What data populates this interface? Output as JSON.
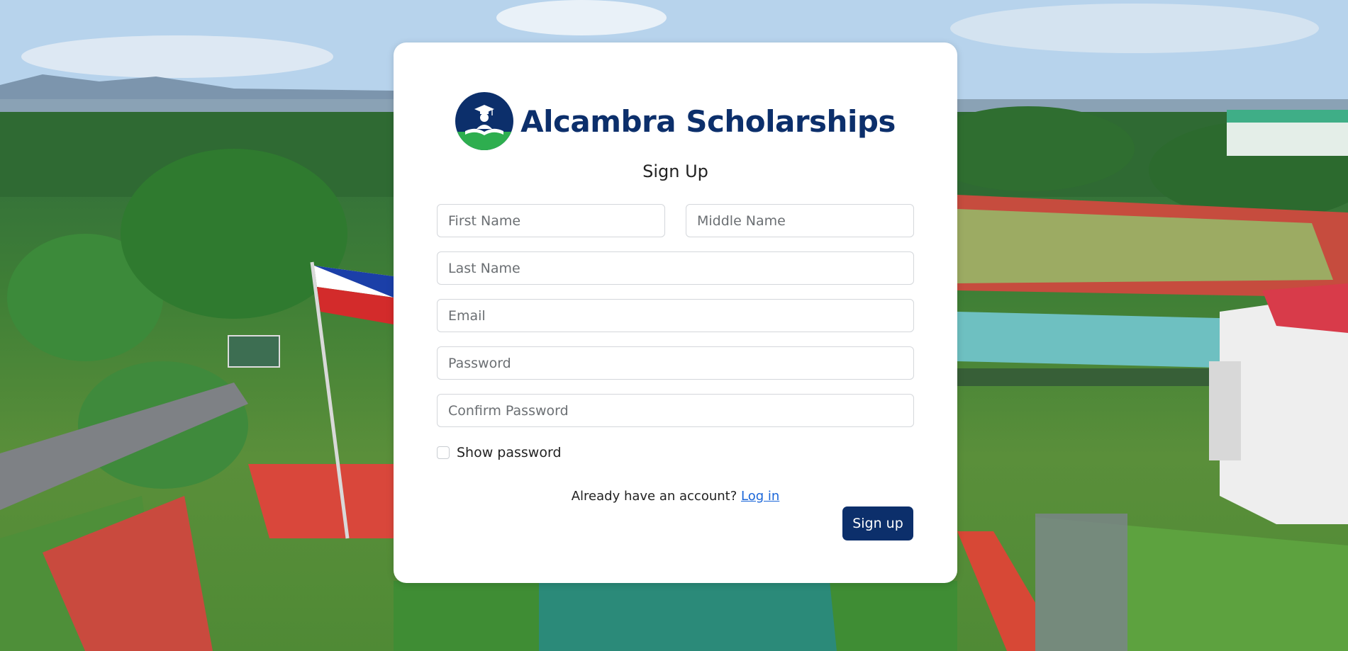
{
  "brand": {
    "name": "Alcambra Scholarships",
    "logo_icon": "graduation-cap-book-icon",
    "logo_color_top": "#0c2f6b",
    "logo_color_bottom": "#2eae4f"
  },
  "form": {
    "title": "Sign Up",
    "fields": {
      "first_name": {
        "placeholder": "First Name",
        "value": ""
      },
      "middle_name": {
        "placeholder": "Middle Name",
        "value": ""
      },
      "last_name": {
        "placeholder": "Last Name",
        "value": ""
      },
      "email": {
        "placeholder": "Email",
        "value": ""
      },
      "password": {
        "placeholder": "Password",
        "value": ""
      },
      "confirm_password": {
        "placeholder": "Confirm Password",
        "value": ""
      }
    },
    "show_password_label": "Show password",
    "show_password_checked": false,
    "already_text": "Already have an account?",
    "login_link": "Log in",
    "submit_label": "Sign up"
  },
  "colors": {
    "primary": "#0c2f6b",
    "link": "#1a66d9",
    "card": "#ffffff"
  }
}
